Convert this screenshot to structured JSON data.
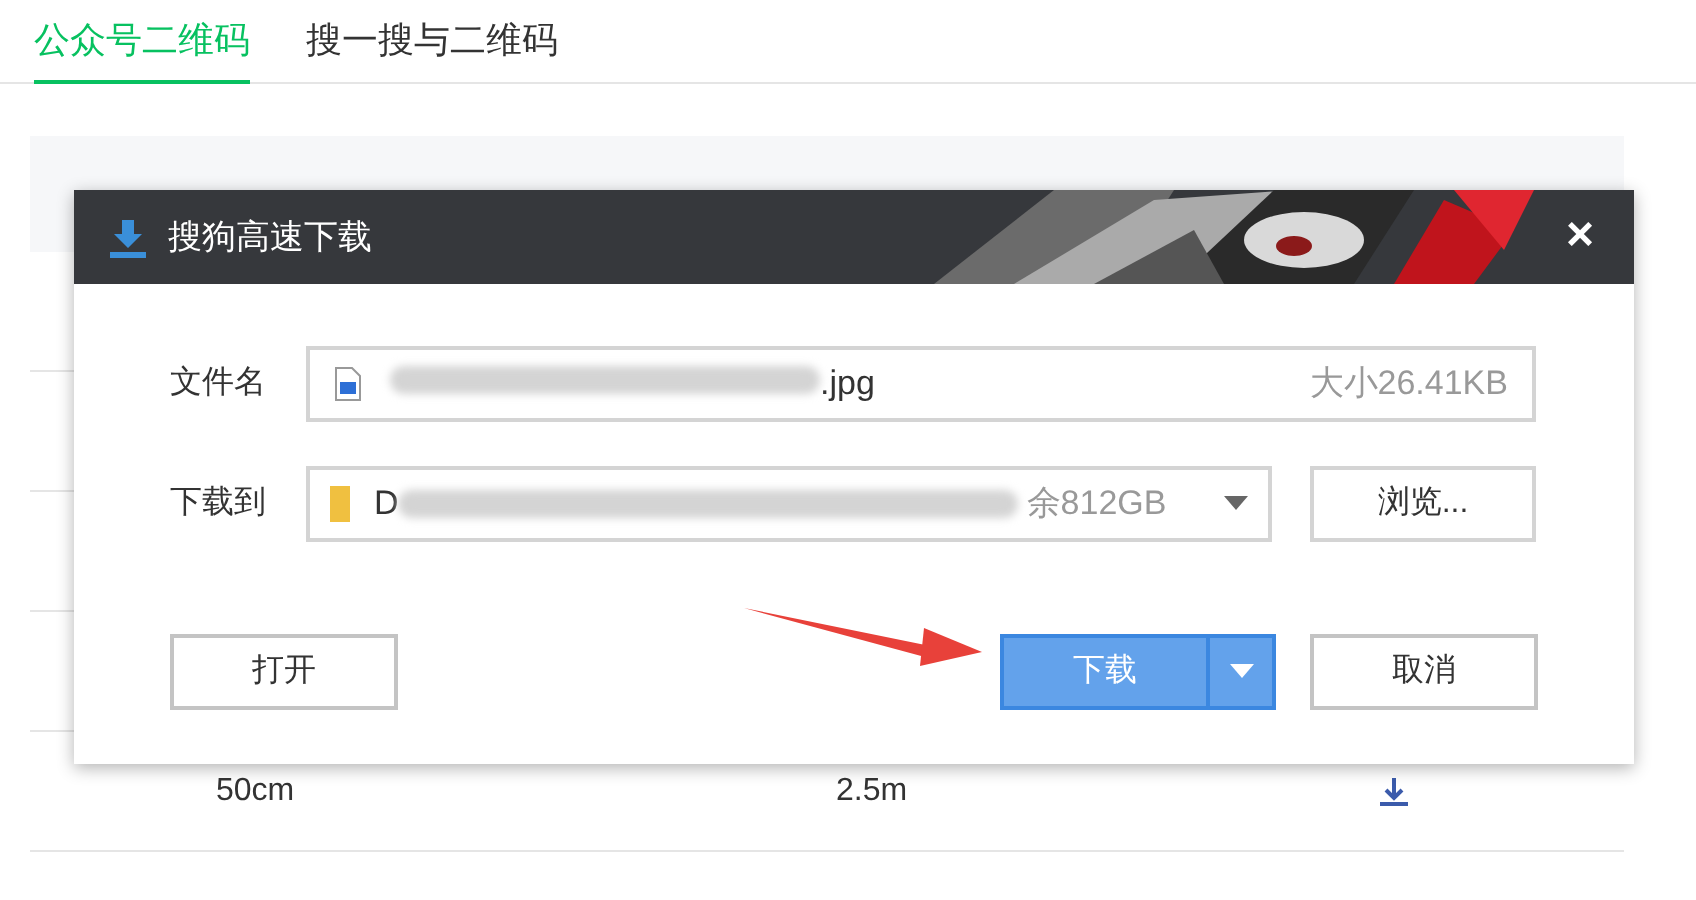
{
  "tabs": [
    {
      "label": "公众号二维码",
      "selected": true
    },
    {
      "label": "搜一搜与二维码",
      "selected": false
    }
  ],
  "table": {
    "rows": [
      {
        "size": "50cm",
        "distance": "2.5m"
      }
    ]
  },
  "dialog": {
    "title": "搜狗高速下载",
    "close": "×",
    "file_label": "文件名",
    "file_name": ".jpg",
    "file_size": "大小26.41KB",
    "path_label": "下载到",
    "path_start": "D",
    "free_space": "余812GB",
    "browse": "浏览...",
    "buttons": [
      {
        "kind": "plain",
        "label": "打开"
      },
      {
        "kind": "primary",
        "label": "下载"
      },
      {
        "kind": "plain",
        "label": "取消"
      }
    ]
  }
}
